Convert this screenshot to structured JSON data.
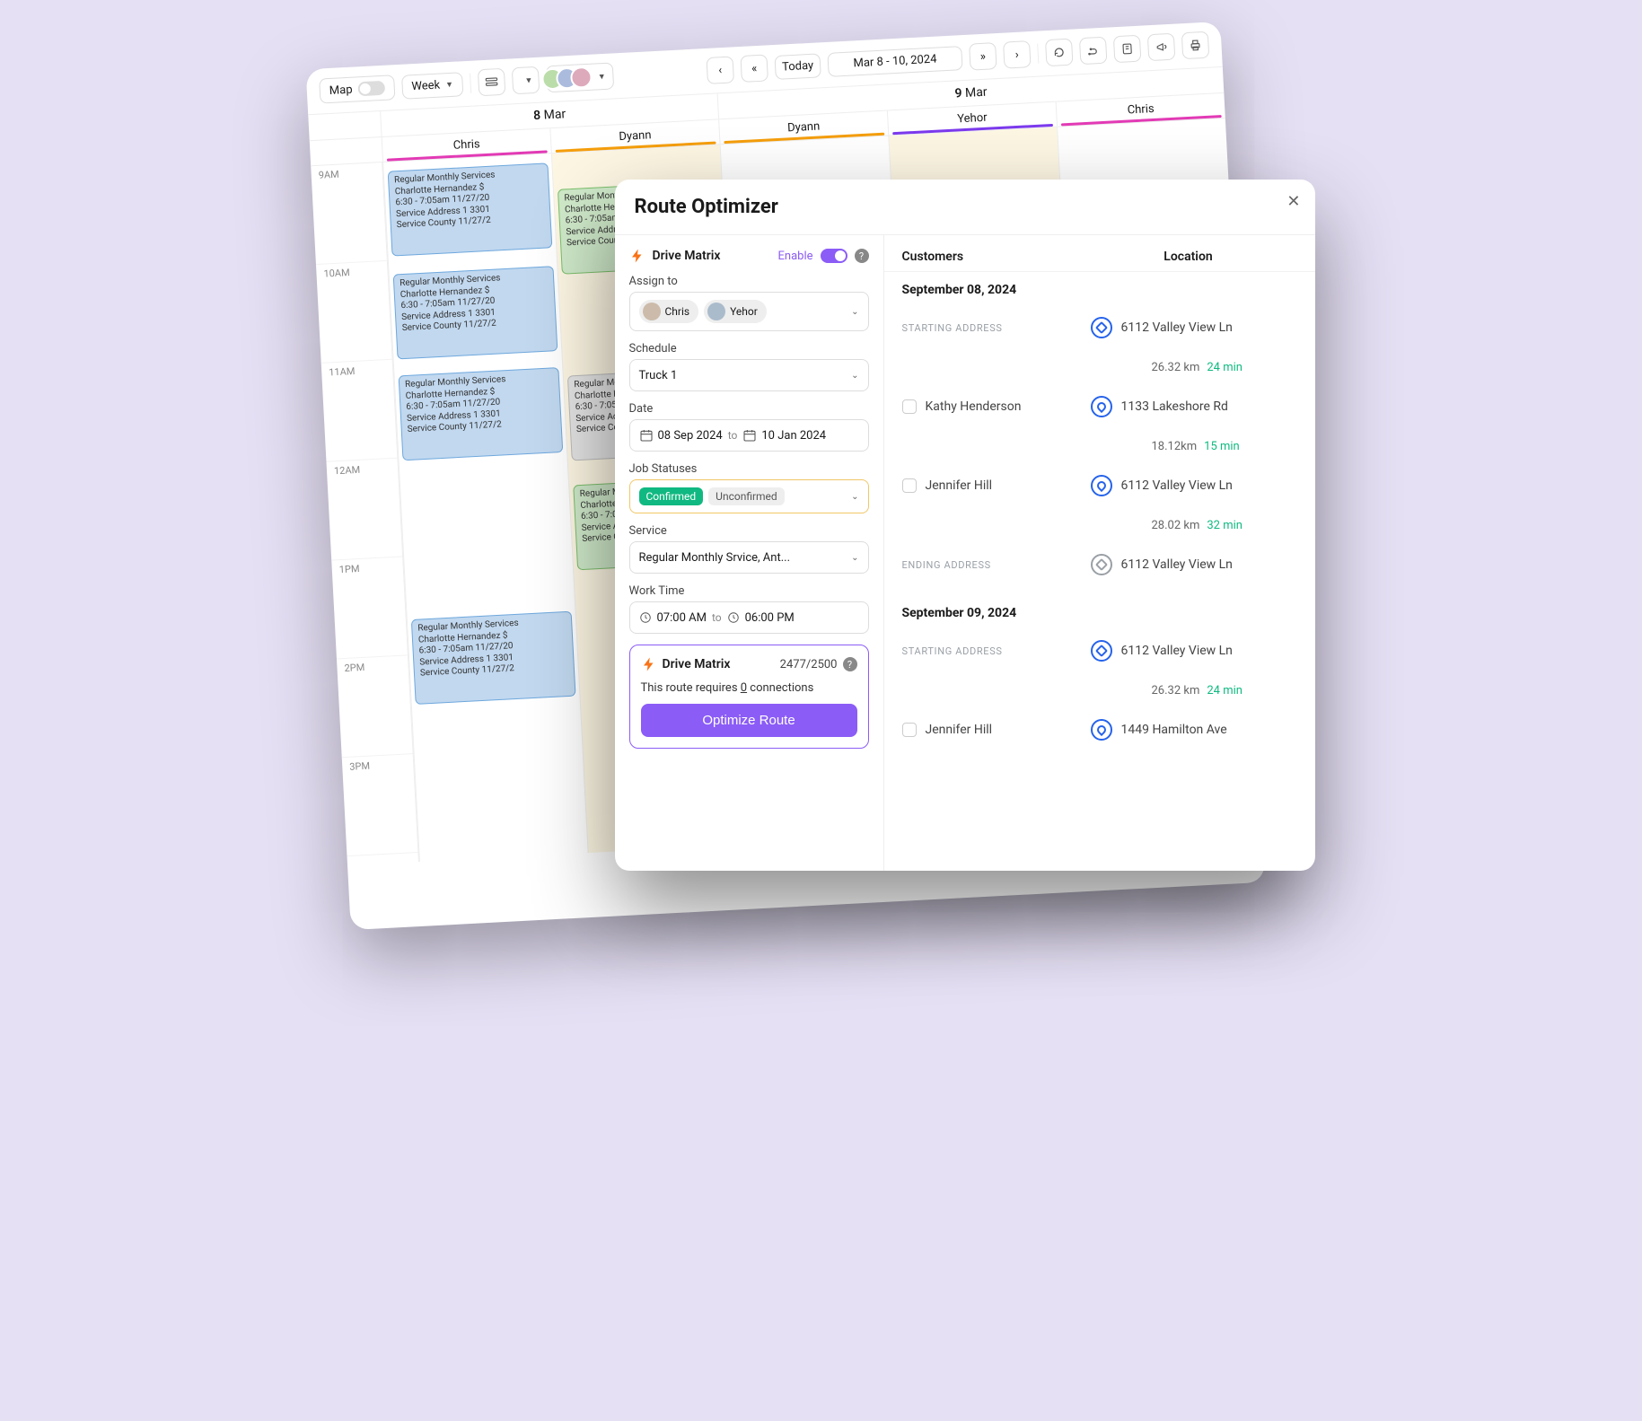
{
  "toolbar": {
    "map_label": "Map",
    "view_label": "Week",
    "today_label": "Today",
    "date_range": "Mar 8 - 10, 2024"
  },
  "calendar": {
    "days": [
      {
        "label": "8",
        "month": "Mar"
      },
      {
        "label": "9",
        "month": "Mar"
      }
    ],
    "people_day1": [
      "Chris",
      "Dyann"
    ],
    "people_day2": [
      "Dyann",
      "Yehor",
      "Chris"
    ],
    "hours": [
      "9AM",
      "10AM",
      "11AM",
      "12AM",
      "1PM",
      "2PM",
      "3PM"
    ],
    "event": {
      "title": "Regular Monthly Services",
      "name": "Charlotte Hernandez  $",
      "time": "6:30 - 7:05am  11/27/20",
      "addr": "Service Address 1  3301",
      "county": "Service County  11/27/2"
    }
  },
  "modal": {
    "title": "Route Optimizer",
    "drive_matrix": "Drive Matrix",
    "enable_label": "Enable",
    "assign_to_label": "Assign to",
    "assignees": [
      "Chris",
      "Yehor"
    ],
    "schedule_label": "Schedule",
    "schedule_value": "Truck 1",
    "date_label": "Date",
    "date_from": "08 Sep 2024",
    "date_to_word": "to",
    "date_to": "10 Jan 2024",
    "job_statuses_label": "Job Statuses",
    "status_confirmed": "Confirmed",
    "status_unconfirmed": "Unconfirmed",
    "service_label": "Service",
    "service_value": "Regular Monthly Srvice, Ant...",
    "work_time_label": "Work Time",
    "work_from": "07:00 AM",
    "work_to": "06:00 PM",
    "dm_box_title": "Drive Matrix",
    "dm_count": "2477/2500",
    "dm_note_pre": "This route requires ",
    "dm_note_num": "0",
    "dm_note_post": " connections",
    "optimize_btn": "Optimize Route"
  },
  "route": {
    "col_customers": "Customers",
    "col_location": "Location",
    "starting_label": "STARTING ADDRESS",
    "ending_label": "ENDING ADDRESS",
    "days": [
      {
        "heading": "September 08, 2024",
        "start_addr": "6112 Valley View Ln",
        "end_addr": "6112 Valley View Ln",
        "stops": [
          {
            "customer": "Kathy Henderson",
            "addr": "1133 Lakeshore Rd",
            "gap_km": "26.32 km",
            "gap_min": "24 min"
          },
          {
            "customer": "Jennifer Hill",
            "addr": "6112 Valley View Ln",
            "gap_km": "18.12km",
            "gap_min": "15 min"
          }
        ],
        "tail_gap_km": "28.02 km",
        "tail_gap_min": "32 min"
      },
      {
        "heading": "September 09, 2024",
        "start_addr": "6112 Valley View Ln",
        "stops": [
          {
            "customer": "Jennifer Hill",
            "addr": "1449 Hamilton Ave",
            "gap_km": "26.32 km",
            "gap_min": "24 min"
          }
        ]
      }
    ]
  }
}
